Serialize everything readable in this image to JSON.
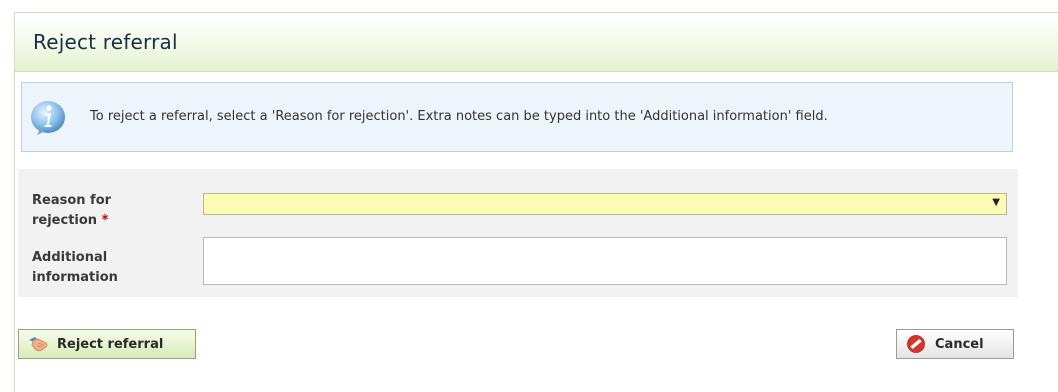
{
  "dialog": {
    "title": "Reject referral"
  },
  "info": {
    "message": "To reject a referral, select a 'Reason for rejection'. Extra notes can be typed into the 'Additional information' field."
  },
  "form": {
    "reason": {
      "label_line1": "Reason for",
      "label_line2": "rejection",
      "required_mark": "*",
      "selected_value": ""
    },
    "additional": {
      "label_line1": "Additional",
      "label_line2": "information",
      "value": ""
    }
  },
  "buttons": {
    "reject_label": "Reject referral",
    "cancel_label": "Cancel"
  },
  "colors": {
    "header_accent": "#e4f1cf",
    "select_background": "#fbfbb4",
    "cancel_icon": "#d9342b"
  }
}
